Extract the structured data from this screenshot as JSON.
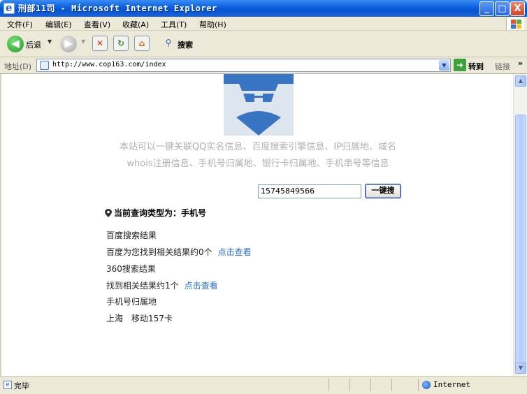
{
  "window": {
    "title": "刑部11司 - Microsoft Internet Explorer",
    "minimize": "_",
    "maximize": "□",
    "close": "X"
  },
  "menu": {
    "items": [
      "文件(F)",
      "编辑(E)",
      "查看(V)",
      "收藏(A)",
      "工具(T)",
      "帮助(H)"
    ]
  },
  "toolbar": {
    "back_label": "后退",
    "search_label": "搜索"
  },
  "address": {
    "label": "地址(D)",
    "url": "http://www.cop163.com/index",
    "go_label": "转到",
    "links_label": "链接",
    "overflow": "»"
  },
  "page": {
    "description_line1": "本站可以一键关联QQ实名信息、百度搜索引擎信息、IP归属地、域名",
    "description_line2": "whois注册信息、手机号归属地、银行卡归属地、手机串号等信息",
    "search_value": "15745849566",
    "search_button": "一键搜",
    "query_type": "当前查询类型为：手机号",
    "results": {
      "baidu_title": "百度搜索结果",
      "baidu_text": "百度为您找到相关结果约0个",
      "baidu_link": "点击查看",
      "s360_title": "360搜索结果",
      "s360_text": "找到相关结果约1个",
      "s360_link": "点击查看",
      "location_title": "手机号归属地",
      "location_text": "上海　移动157卡"
    }
  },
  "status": {
    "text": "完毕",
    "zone": "Internet"
  },
  "colors": {
    "titlebar": "#0a5fdc",
    "link": "#2a6ec6",
    "logo_blue": "#3a75c4",
    "description": "#b0b0b0"
  }
}
